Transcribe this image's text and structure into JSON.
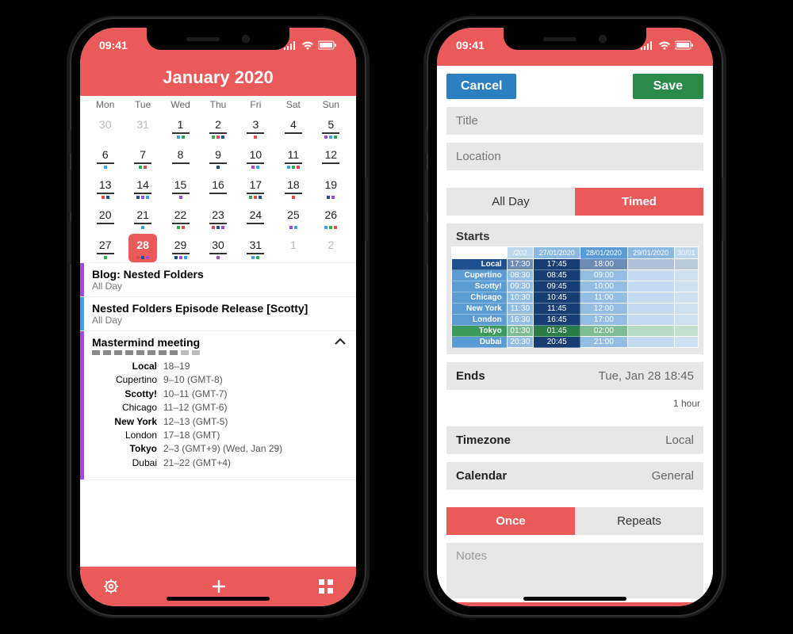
{
  "status": {
    "time": "09:41"
  },
  "left": {
    "title": "January 2020",
    "weekdays": [
      "Mon",
      "Tue",
      "Wed",
      "Thu",
      "Fri",
      "Sat",
      "Sun"
    ],
    "days": [
      {
        "n": "30",
        "dim": true
      },
      {
        "n": "31",
        "dim": true
      },
      {
        "n": "1",
        "u": true
      },
      {
        "n": "2",
        "u": true
      },
      {
        "n": "3",
        "u": true
      },
      {
        "n": "4",
        "u": true
      },
      {
        "n": "5",
        "u": true
      },
      {
        "n": "6",
        "u": true
      },
      {
        "n": "7",
        "u": true
      },
      {
        "n": "8",
        "u": true
      },
      {
        "n": "9",
        "u": true
      },
      {
        "n": "10",
        "u": true
      },
      {
        "n": "11",
        "u": true
      },
      {
        "n": "12",
        "u": true
      },
      {
        "n": "13",
        "u": true
      },
      {
        "n": "14",
        "u": true
      },
      {
        "n": "15",
        "u": true
      },
      {
        "n": "16",
        "u": true
      },
      {
        "n": "17",
        "u": true
      },
      {
        "n": "18",
        "u": true
      },
      {
        "n": "19"
      },
      {
        "n": "20",
        "u": true
      },
      {
        "n": "21",
        "u": true
      },
      {
        "n": "22",
        "u": true
      },
      {
        "n": "23",
        "u": true
      },
      {
        "n": "24",
        "u": true
      },
      {
        "n": "25"
      },
      {
        "n": "26"
      },
      {
        "n": "27",
        "u": true
      },
      {
        "n": "28",
        "sel": true
      },
      {
        "n": "29",
        "u": true
      },
      {
        "n": "30",
        "u": true
      },
      {
        "n": "31",
        "u": true
      },
      {
        "n": "1",
        "dim": true
      },
      {
        "n": "2",
        "dim": true
      }
    ],
    "events": [
      {
        "bar": "#a44ad6",
        "title": "Blog: Nested Folders",
        "sub": "All Day"
      },
      {
        "bar": "#3aa6e8",
        "title": "Nested Folders Episode Release [Scotty]",
        "sub": "All Day"
      }
    ],
    "detail": {
      "bar": "#a44ad6",
      "title": "Mastermind meeting",
      "rows": [
        {
          "lab": "Local",
          "val": "18–19",
          "bold": true
        },
        {
          "lab": "Cupertino",
          "val": "9–10 (GMT-8)"
        },
        {
          "lab": "Scotty!",
          "val": "10–11 (GMT-7)",
          "bold": true
        },
        {
          "lab": "Chicago",
          "val": "11–12 (GMT-6)"
        },
        {
          "lab": "New York",
          "val": "12–13 (GMT-5)",
          "bold": true
        },
        {
          "lab": "London",
          "val": "17–18 (GMT)"
        },
        {
          "lab": "Tokyo",
          "val": "2–3 (GMT+9) (Wed, Jan 29)",
          "bold": true
        },
        {
          "lab": "Dubai",
          "val": "21–22 (GMT+4)"
        }
      ]
    }
  },
  "right": {
    "cancel": "Cancel",
    "save": "Save",
    "title_ph": "Title",
    "location_ph": "Location",
    "seg": {
      "allday": "All Day",
      "timed": "Timed"
    },
    "starts": "Starts",
    "picker": {
      "dates": [
        "/202",
        "27/01/2020",
        "28/01/2020",
        "29/01/2020",
        "30/01"
      ],
      "rows": [
        {
          "lab": "Local",
          "bg": "#1e4f8f",
          "cells": [
            "17:30",
            "17:45",
            "18:00",
            ""
          ]
        },
        {
          "lab": "Cupertino",
          "bg": "#5a9bd4",
          "cells": [
            "08:30",
            "08:45",
            "09:00",
            ""
          ]
        },
        {
          "lab": "Scotty!",
          "bg": "#5a9bd4",
          "cells": [
            "09:30",
            "09:45",
            "10:00",
            ""
          ]
        },
        {
          "lab": "Chicago",
          "bg": "#5a9bd4",
          "cells": [
            "10:30",
            "10:45",
            "11:00",
            ""
          ]
        },
        {
          "lab": "New York",
          "bg": "#5a9bd4",
          "cells": [
            "11:30",
            "11:45",
            "12:00",
            ""
          ]
        },
        {
          "lab": "London",
          "bg": "#5a9bd4",
          "cells": [
            "16:30",
            "16:45",
            "17:00",
            ""
          ]
        },
        {
          "lab": "Tokyo",
          "bg": "#3a9a5a",
          "cells": [
            "01:30",
            "01:45",
            "02:00",
            ""
          ]
        },
        {
          "lab": "Dubai",
          "bg": "#5a9bd4",
          "cells": [
            "20:30",
            "20:45",
            "21:00",
            ""
          ]
        }
      ]
    },
    "ends_lab": "Ends",
    "ends_val": "Tue, Jan 28 18:45",
    "duration": "1 hour",
    "tz_lab": "Timezone",
    "tz_val": "Local",
    "cal_lab": "Calendar",
    "cal_val": "General",
    "seg2": {
      "once": "Once",
      "repeats": "Repeats"
    },
    "notes_ph": "Notes"
  }
}
